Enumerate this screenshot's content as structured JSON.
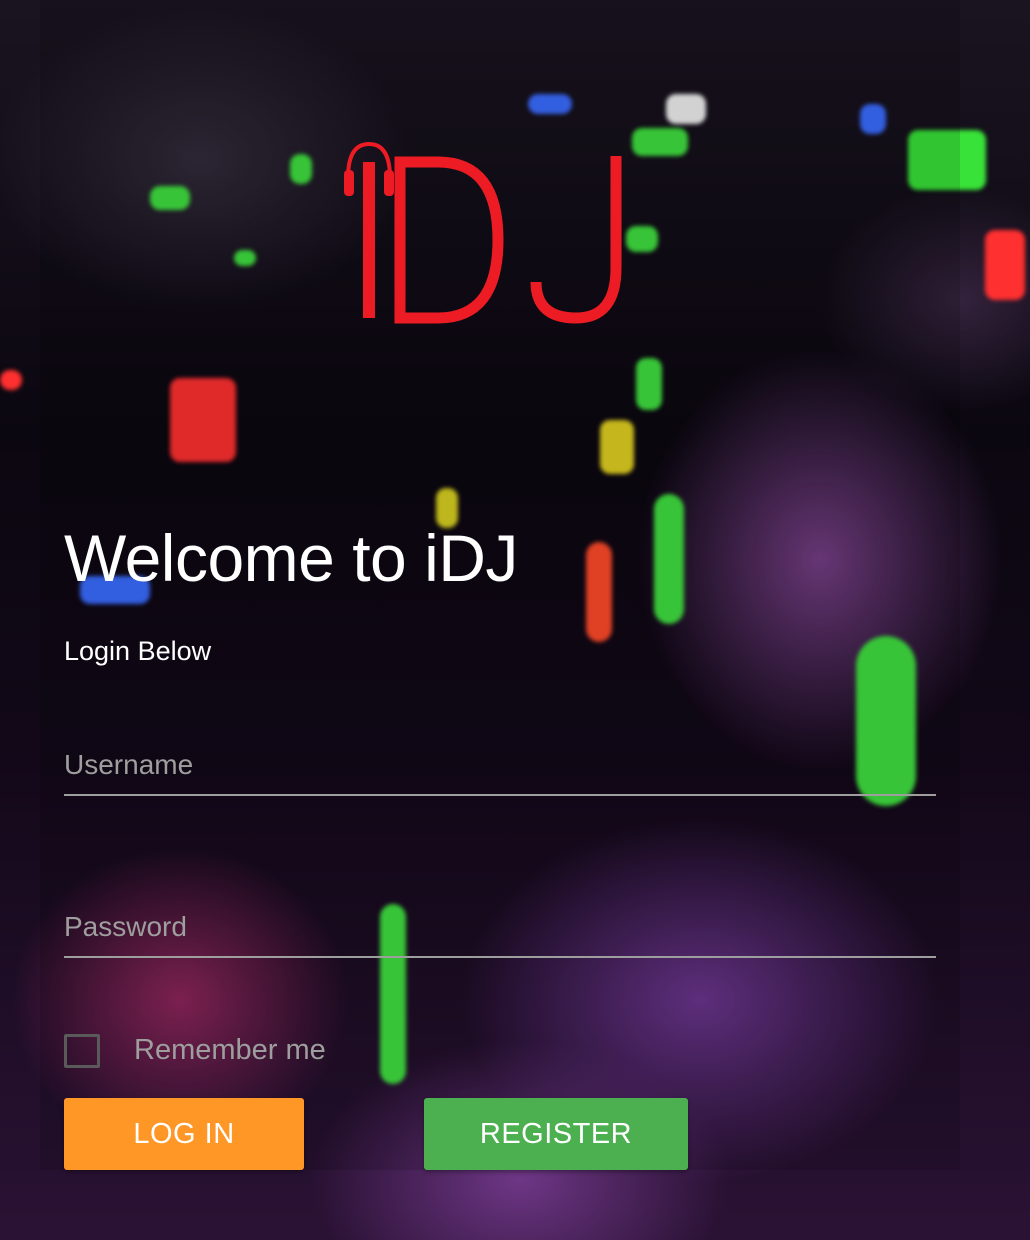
{
  "logo": {
    "text": "iDJ",
    "icon": "headphones-icon",
    "color": "#ed1c24"
  },
  "welcome": {
    "title": "Welcome to iDJ",
    "subtitle": "Login Below"
  },
  "form": {
    "username_placeholder": "Username",
    "password_placeholder": "Password",
    "remember_label": "Remember me"
  },
  "buttons": {
    "login_label": "LOG IN",
    "register_label": "REGISTER"
  },
  "colors": {
    "login": "#ff9726",
    "register": "#4caf50",
    "field_line": "#9e9e9e"
  }
}
